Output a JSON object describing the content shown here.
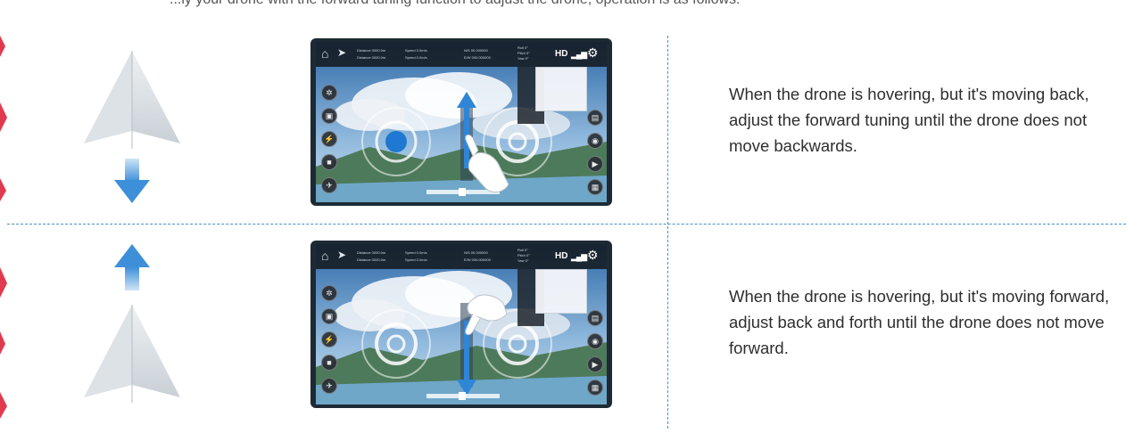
{
  "intro_line": "...ly your drone with the forward tuning function to adjust the drone, operation is as follows:",
  "rows": [
    {
      "description": "When the drone is hovering, but it's moving back, adjust the forward tuning until the drone does not move backwards.",
      "arrow_direction": "down",
      "gesture": "swipe-up"
    },
    {
      "description": "When the drone is hovering, but it's moving forward, adjust back and forth until the drone does not move forward.",
      "arrow_direction": "up",
      "gesture": "swipe-down"
    }
  ],
  "app_screen": {
    "hd_label": "HD",
    "topbar_lines": [
      "Distance 0000.0m",
      "Distance 0000.0m",
      "Speed 0.0m/s",
      "Speed 0.0m/s",
      "N/S 00.000000",
      "E/W 000.000000",
      "Roll 0°",
      "Pitch 0°",
      "Yaw 0°"
    ]
  },
  "colors": {
    "accent_blue": "#3d8fd9",
    "separator_blue": "#4a8fcb",
    "edge_red": "#d8263c"
  }
}
